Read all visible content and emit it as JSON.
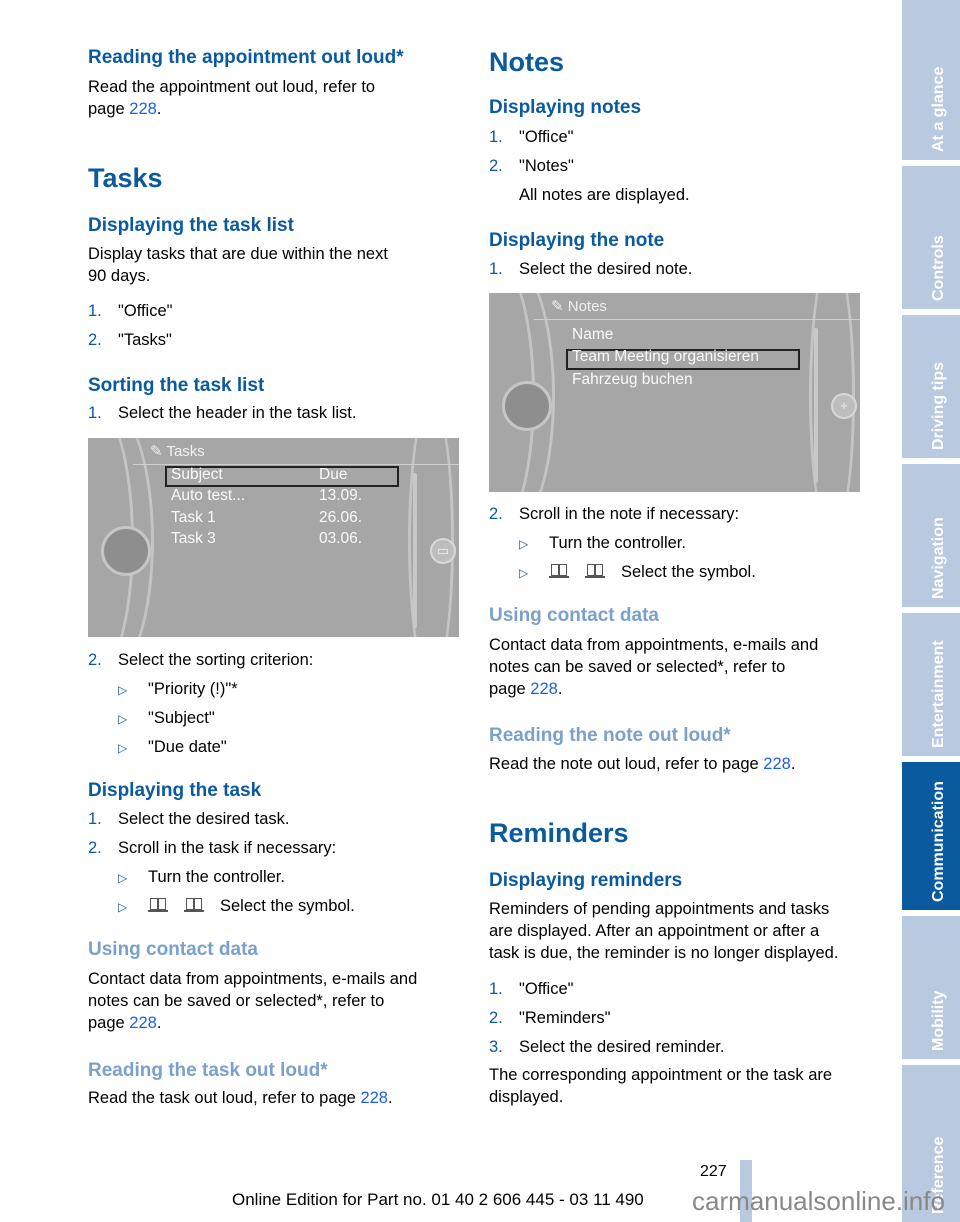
{
  "left": {
    "reading_appt_heading": "Reading the appointment out loud*",
    "reading_appt_text": "Read the appointment out loud, refer to",
    "reading_appt_text2": "page ",
    "link_page": "228",
    "period": ".",
    "tasks_heading": "Tasks",
    "display_tasklist_heading": "Displaying the task list",
    "display_tasklist_text1": "Display tasks that are due within the next",
    "display_tasklist_text2": "90 days.",
    "steps1": [
      {
        "n": "1.",
        "t": "\"Office\""
      },
      {
        "n": "2.",
        "t": "\"Tasks\""
      }
    ],
    "sorting_heading": "Sorting the task list",
    "sorting_step1": {
      "n": "1.",
      "t": "Select the header in the task list."
    },
    "tasks_screen": {
      "title": "Tasks",
      "header": {
        "subject": "Subject",
        "due": "Due"
      },
      "rows": [
        {
          "subject": "Auto test...",
          "due": "13.09."
        },
        {
          "subject": "Task 1",
          "due": "26.06."
        },
        {
          "subject": "Task 3",
          "due": "03.06."
        }
      ]
    },
    "sorting_step2": {
      "n": "2.",
      "t": "Select the sorting criterion:"
    },
    "sort_options": [
      "\"Priority (!)\"*",
      "\"Subject\"",
      "\"Due date\""
    ],
    "display_task_heading": "Displaying the task",
    "display_task_steps": [
      {
        "n": "1.",
        "t": "Select the desired task."
      },
      {
        "n": "2.",
        "t": "Scroll in the task if necessary:"
      }
    ],
    "scroll_options": [
      "Turn the controller.",
      "Select the symbol."
    ],
    "contact_heading": "Using contact data",
    "contact_text1": "Contact data from appointments, e-mails and",
    "contact_text2": "notes can be saved or selected*, refer to",
    "contact_text3": "page ",
    "read_task_heading": "Reading the task out loud*",
    "read_task_text": "Read the task out loud, refer to page "
  },
  "right": {
    "notes_heading": "Notes",
    "display_notes_heading": "Displaying notes",
    "steps1": [
      {
        "n": "1.",
        "t": "\"Office\""
      },
      {
        "n": "2.",
        "t": "\"Notes\""
      }
    ],
    "all_notes": "All notes are displayed.",
    "display_note_heading": "Displaying the note",
    "display_note_step1": {
      "n": "1.",
      "t": "Select the desired note."
    },
    "notes_screen": {
      "title": "Notes",
      "rows": [
        "Name",
        "Team Meeting organisieren",
        "Fahrzeug buchen"
      ]
    },
    "display_note_step2": {
      "n": "2.",
      "t": "Scroll in the note if necessary:"
    },
    "scroll_options": [
      "Turn the controller.",
      "Select the symbol."
    ],
    "contact_heading": "Using contact data",
    "contact_text1": "Contact data from appointments, e-mails and",
    "contact_text2": "notes can be saved or selected*, refer to",
    "contact_text3": "page ",
    "read_note_heading": "Reading the note out loud*",
    "read_note_text": "Read the note out loud, refer to page ",
    "reminders_heading": "Reminders",
    "display_reminders_heading": "Displaying reminders",
    "reminders_text1": "Reminders of pending appointments and tasks",
    "reminders_text2": "are displayed. After an appointment or after a",
    "reminders_text3": "task is due, the reminder is no longer displayed.",
    "reminder_steps": [
      {
        "n": "1.",
        "t": "\"Office\""
      },
      {
        "n": "2.",
        "t": "\"Reminders\""
      },
      {
        "n": "3.",
        "t": "Select the desired reminder."
      }
    ],
    "closing_text1": "The corresponding appointment or the task are",
    "closing_text2": "displayed."
  },
  "tabs": [
    {
      "label": "At a glance",
      "active": false
    },
    {
      "label": "Controls",
      "active": false
    },
    {
      "label": "Driving tips",
      "active": false
    },
    {
      "label": "Navigation",
      "active": false
    },
    {
      "label": "Entertainment",
      "active": false
    },
    {
      "label": "Communication",
      "active": true
    },
    {
      "label": "Mobility",
      "active": false
    },
    {
      "label": "Reference",
      "active": false
    }
  ],
  "footer": {
    "page_number": "227",
    "edition": "Online Edition for Part no. 01 40 2 606 445 - 03 11 490",
    "watermark": "carmanualsonline.info"
  },
  "bullet_glyph": "▷"
}
